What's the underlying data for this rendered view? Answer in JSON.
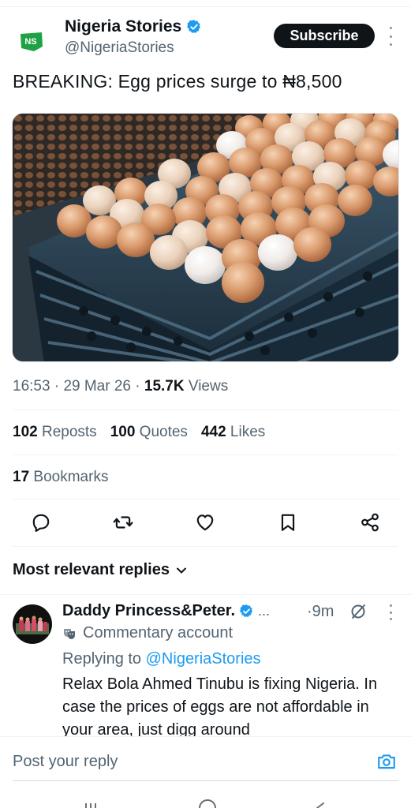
{
  "post": {
    "author_name": "Nigeria Stories",
    "author_handle": "@NigeriaStories",
    "logo_text": "NS",
    "subscribe_label": "Subscribe",
    "text": "BREAKING: Egg prices surge to ₦8,500",
    "time": "16:53",
    "date": "29 Mar 26",
    "views_count": "15.7K",
    "views_label": "Views",
    "reposts_count": "102",
    "reposts_label": "Reposts",
    "quotes_count": "100",
    "quotes_label": "Quotes",
    "likes_count": "442",
    "likes_label": "Likes",
    "bookmarks_count": "17",
    "bookmarks_label": "Bookmarks"
  },
  "actions": [
    "reply-icon",
    "repost-icon",
    "like-icon",
    "bookmark-icon",
    "share-icon"
  ],
  "replies_header": "Most relevant replies",
  "reply": {
    "name": "Daddy Princess&Peter.",
    "ellipsis": "...",
    "time": "·9m",
    "commentary": "Commentary account",
    "replying_to_label": "Replying to",
    "replying_to_handle": "@NigeriaStories",
    "text": "Relax Bola Ahmed Tinubu is fixing Nigeria. In case the prices of eggs are not affordable in your area, just digg around"
  },
  "composer": {
    "placeholder": "Post your reply"
  },
  "colors": {
    "accent": "#1d9bf0",
    "text_primary": "#0f1419",
    "text_secondary": "#536471",
    "verified": "#1d9bf0",
    "logo_green": "#1fa246"
  }
}
